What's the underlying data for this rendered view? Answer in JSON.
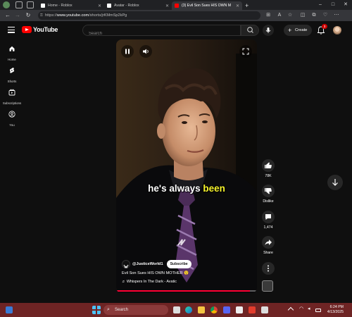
{
  "browser": {
    "tabs": [
      {
        "label": "Home - Roblox",
        "active": false
      },
      {
        "label": "Avatar - Roblox",
        "active": false
      },
      {
        "label": "(3) Evil Son Sues HIS OWN M",
        "active": true
      }
    ],
    "new_tab": "+",
    "url_prefix": "https://",
    "url_host": "www.youtube.com",
    "url_path": "/shorts/jrKMmSp2kPg",
    "window_controls": [
      "–",
      "□",
      "✕"
    ]
  },
  "youtube": {
    "logo_text": "YouTube",
    "search_placeholder": "Search",
    "create_label": "Create",
    "notification_count": "3"
  },
  "sidebar": {
    "items": [
      {
        "label": "Home",
        "icon": "home-icon"
      },
      {
        "label": "Shorts",
        "icon": "shorts-icon"
      },
      {
        "label": "Subscriptions",
        "icon": "subscriptions-icon"
      },
      {
        "label": "You",
        "icon": "you-icon"
      }
    ]
  },
  "short": {
    "caption_pre": "he's always ",
    "caption_hl": "been",
    "caption_color": "#f6f32b",
    "channel": "@JusticeWorld1",
    "subscribe_label": "Subscribe",
    "title": "Evil Son Sues HIS OWN MOTHER 😲",
    "music": "♬ Whispers In The Dark - Avatic",
    "progress": 0.95
  },
  "actions": {
    "likes": "78K",
    "dislike_label": "Dislike",
    "comments": "1,474",
    "share_label": "Share"
  },
  "taskbar": {
    "search_label": "Search",
    "time": "6:24 PM",
    "date": "4/13/2025",
    "color": "#6e2424"
  }
}
